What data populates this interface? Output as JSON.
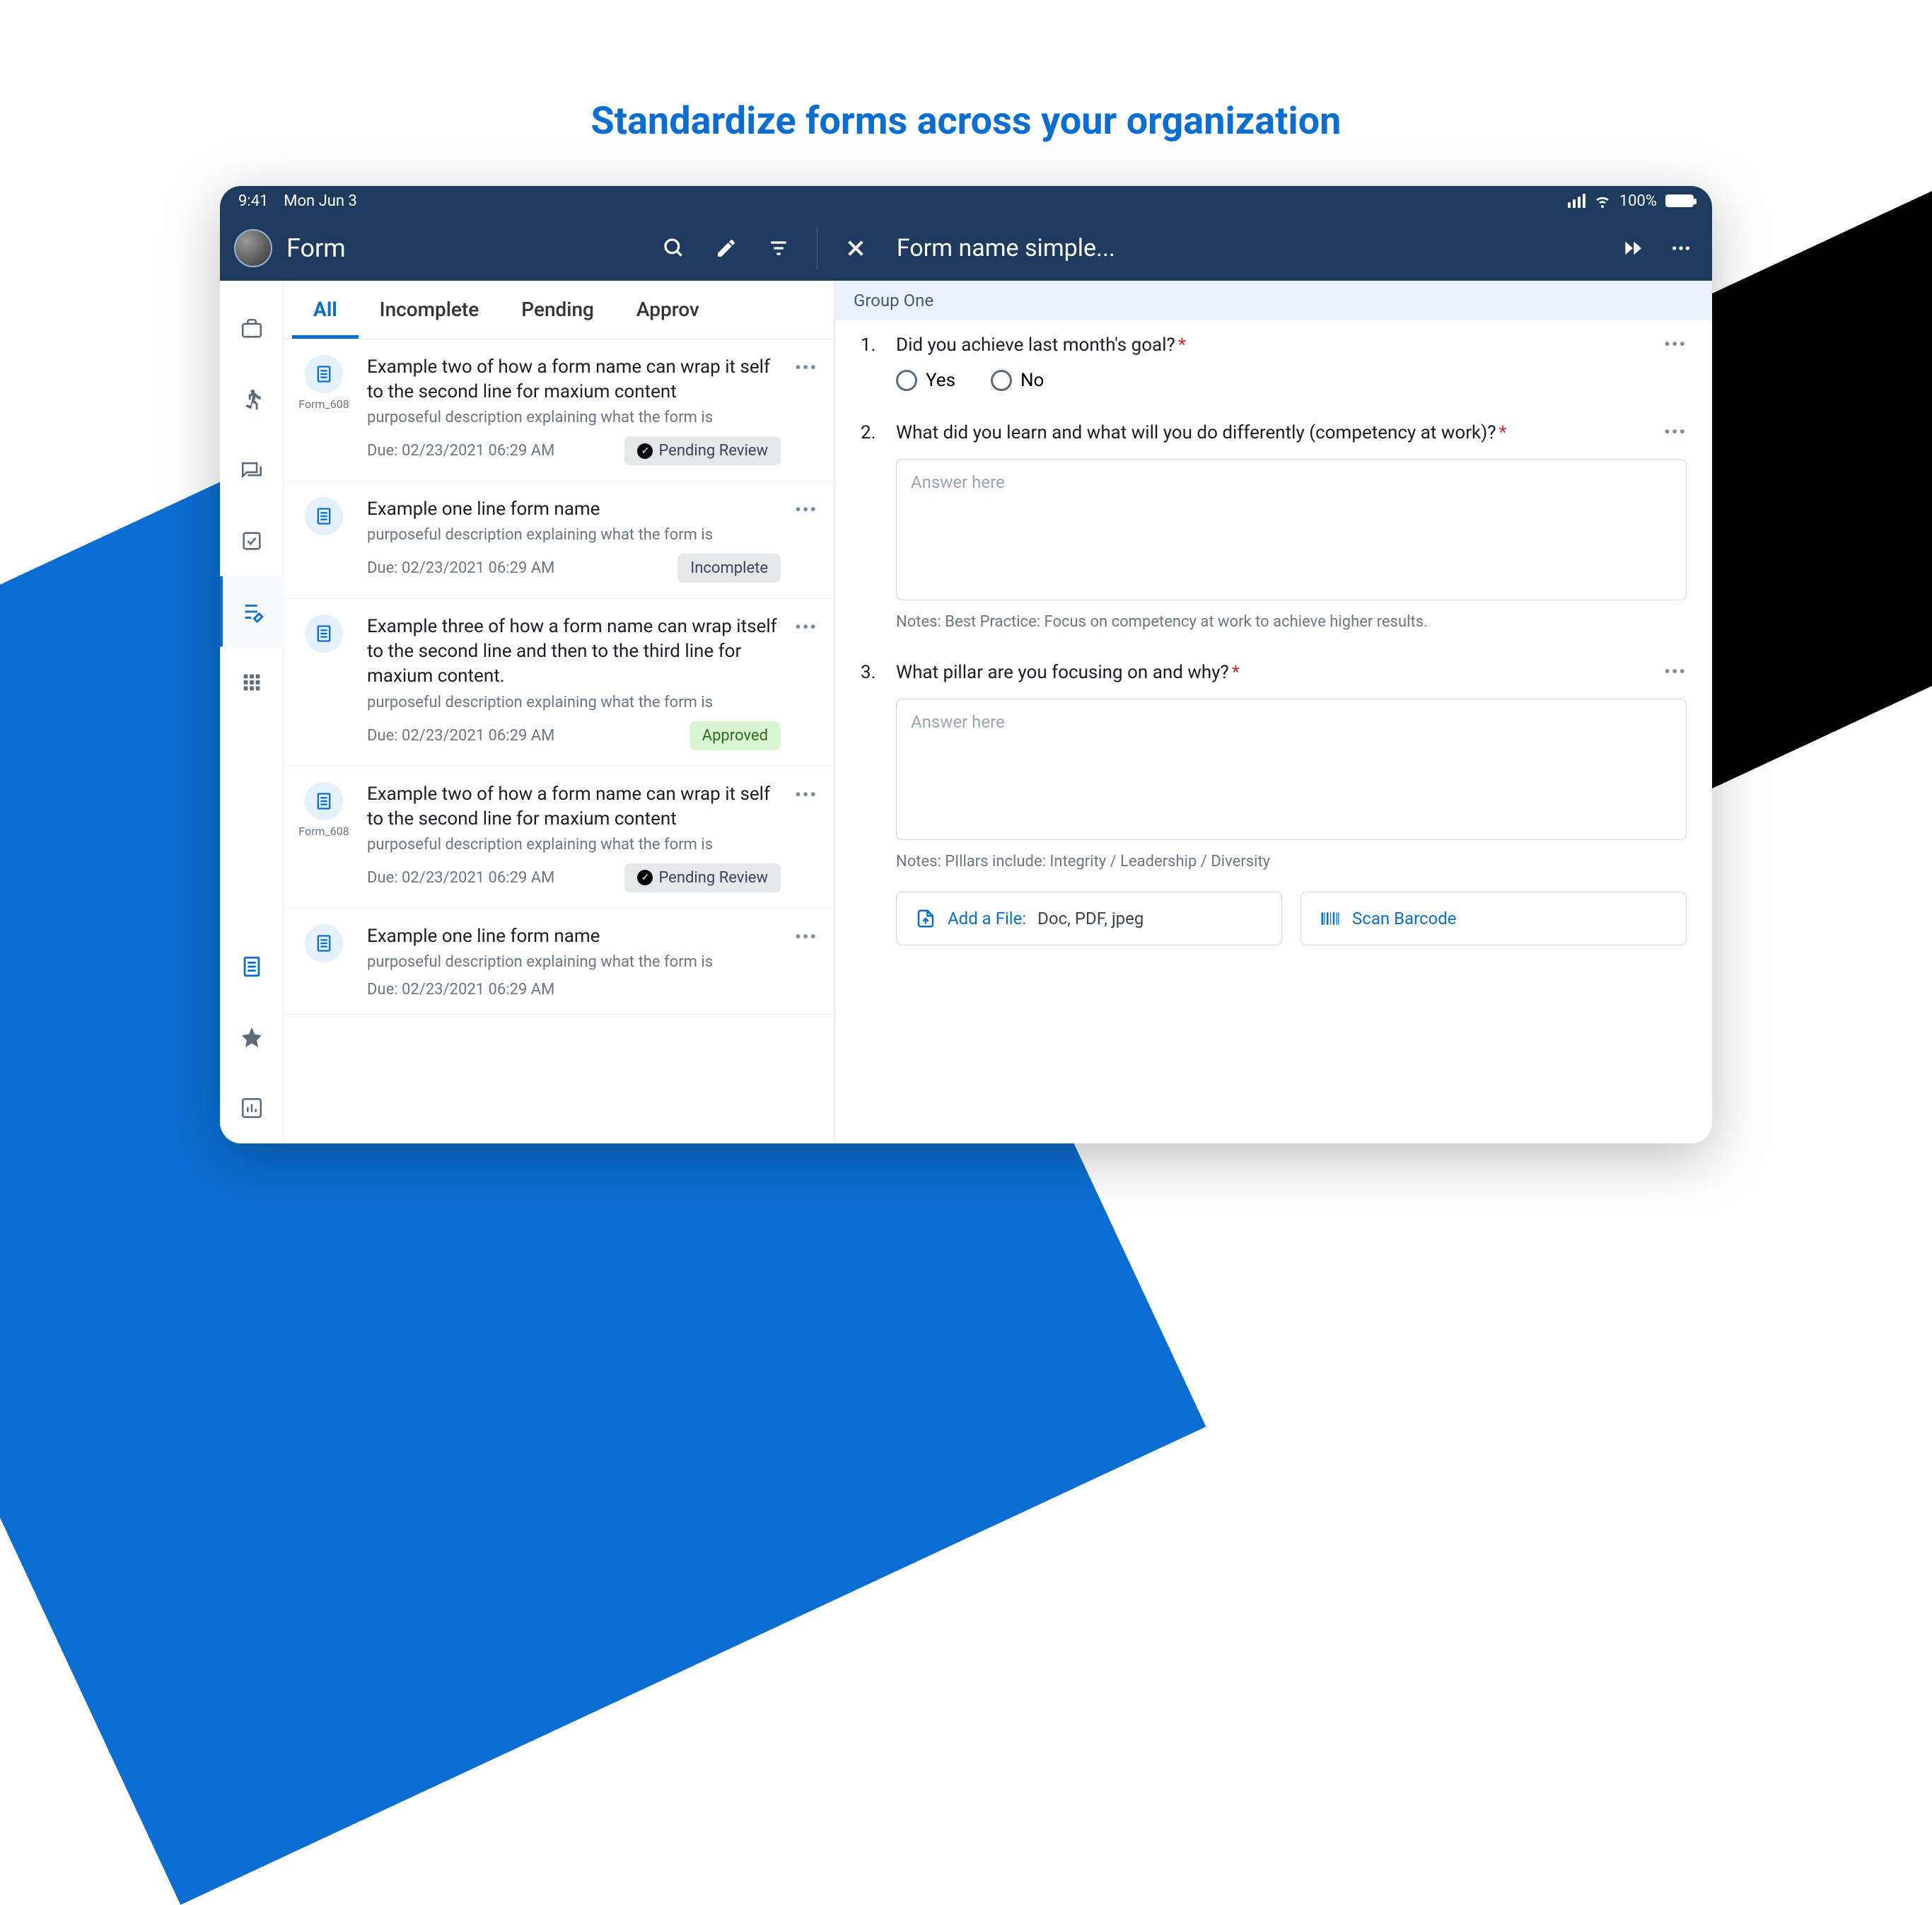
{
  "headline": "Standardize forms across your organization",
  "status": {
    "time": "9:41",
    "date": "Mon Jun 3",
    "battery": "100%"
  },
  "app": {
    "title": "Form",
    "secondary_title": "Form name simple..."
  },
  "tabs": [
    {
      "label": "All",
      "active": true
    },
    {
      "label": "Incomplete",
      "active": false
    },
    {
      "label": "Pending",
      "active": false
    },
    {
      "label": "Approv",
      "active": false
    }
  ],
  "rail_icons": [
    "briefcase",
    "walk",
    "chat",
    "check-square",
    "edit-list",
    "grid",
    "document",
    "star",
    "chart"
  ],
  "forms": [
    {
      "id": "Form_608",
      "name": "Example two of how a form name can wrap it self to the  second line for maxium content",
      "desc": "purposeful description explaining what the form is",
      "due": "Due: 02/23/2021 06:29 AM",
      "status": "Pending Review",
      "status_kind": "pending"
    },
    {
      "id": "",
      "name": "Example one line form name",
      "desc": "purposeful description explaining what the form is",
      "due": "Due: 02/23/2021 06:29 AM",
      "status": "Incomplete",
      "status_kind": "incomplete"
    },
    {
      "id": "",
      "name": "Example three of how a form name can wrap itself to the second line and then to the third line for maxium content.",
      "desc": "purposeful description explaining what the form is",
      "due": "Due: 02/23/2021 06:29 AM",
      "status": "Approved",
      "status_kind": "approved"
    },
    {
      "id": "Form_608",
      "name": "Example two of how a form name can wrap it self to the  second line for maxium content",
      "desc": "purposeful description explaining what the form is",
      "due": "Due: 02/23/2021 06:29 AM",
      "status": "Pending Review",
      "status_kind": "pending"
    },
    {
      "id": "",
      "name": "Example one line form name",
      "desc": "purposeful description explaining what the form is",
      "due": "Due: 02/23/2021 06:29 AM",
      "status": "",
      "status_kind": ""
    }
  ],
  "detail": {
    "group_title": "Group One",
    "questions": [
      {
        "num": "1.",
        "text": "Did you achieve last month's goal?",
        "required": true,
        "type": "radio",
        "options": [
          "Yes",
          "No"
        ]
      },
      {
        "num": "2.",
        "text": "What did you learn and what will you do differently (competency at work)?",
        "required": true,
        "type": "textarea",
        "placeholder": "Answer here",
        "notes": "Notes: Best Practice: Focus on competency at work to achieve higher results."
      },
      {
        "num": "3.",
        "text": "What pillar are you focusing on and why?",
        "required": true,
        "type": "textarea",
        "placeholder": "Answer here",
        "notes": "Notes: PIllars include: Integrity / Leadership / Diversity"
      }
    ],
    "add_file_label": "Add a File:",
    "add_file_hint": "Doc, PDF, jpeg",
    "scan_label": "Scan Barcode"
  }
}
